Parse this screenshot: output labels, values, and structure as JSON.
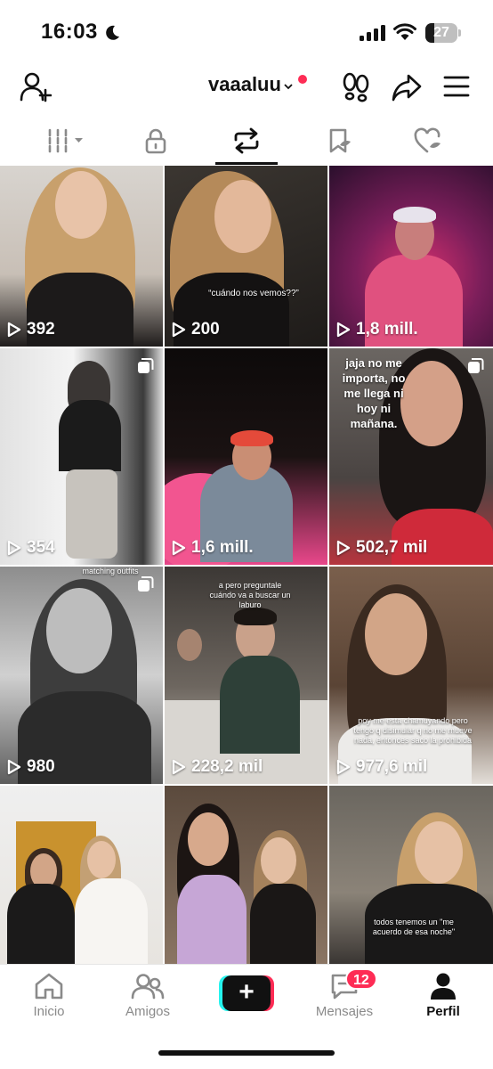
{
  "status_bar": {
    "time": "16:03",
    "battery": "27",
    "battery_level": 0.27
  },
  "header": {
    "username": "vaaaluu",
    "icons": [
      "add-user-icon",
      "chevron-down-icon",
      "footprint-icon",
      "share-icon",
      "menu-icon"
    ]
  },
  "tabs": [
    {
      "name": "videos",
      "icon": "grid-icon"
    },
    {
      "name": "private",
      "icon": "lock-icon"
    },
    {
      "name": "reposts",
      "icon": "repost-icon",
      "active": true
    },
    {
      "name": "favorites",
      "icon": "bookmark-icon"
    },
    {
      "name": "liked",
      "icon": "heart-icon"
    }
  ],
  "videos": [
    {
      "views": "392",
      "caption": ""
    },
    {
      "views": "200",
      "caption": "“cuándo nos vemos??”"
    },
    {
      "views": "1,8 mill.",
      "caption": ""
    },
    {
      "views": "354",
      "caption": "",
      "multi": true
    },
    {
      "views": "1,6 mill.",
      "caption": ""
    },
    {
      "views": "502,7 mil",
      "caption": "jaja no me importa, no me llega ni hoy ni mañana.",
      "multi": true
    },
    {
      "views": "980",
      "caption": "matching outfits",
      "multi": true
    },
    {
      "views": "228,2 mil",
      "caption": "a pero preguntale cuándo va a buscar un laburo"
    },
    {
      "views": "977,6 mil",
      "caption": "poy me esta chamuyando pero tengo q disimular q no me mueve nada, entonces saco la prohibida"
    },
    {
      "views": "",
      "caption": ""
    },
    {
      "views": "",
      "caption": ""
    },
    {
      "views": "",
      "caption": "todos tenemos un \"me acuerdo de esa noche\""
    }
  ],
  "bottom_nav": {
    "home": "Inicio",
    "friends": "Amigos",
    "messages": "Mensajes",
    "messages_badge": "12",
    "profile": "Perfil"
  },
  "colors": {
    "accent_red": "#fe2c55",
    "accent_cyan": "#25f4ee"
  }
}
